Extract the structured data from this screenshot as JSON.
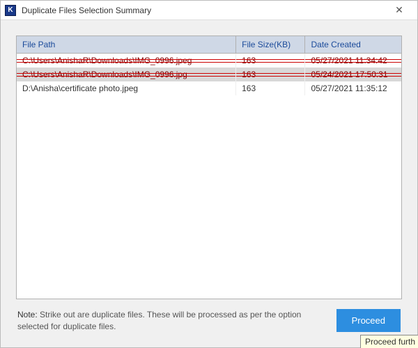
{
  "window": {
    "title": "Duplicate Files Selection Summary",
    "icon_letter": "K"
  },
  "table": {
    "headers": {
      "path": "File Path",
      "size": "File Size(KB)",
      "date": "Date Created"
    },
    "rows": [
      {
        "path": "C:\\Users\\AnishaR\\Downloads\\IMG_0996.jpeg",
        "size": "163",
        "date": "05/27/2021 11:34:42",
        "strike": true
      },
      {
        "path": "C:\\Users\\AnishaR\\Downloads\\IMG_0996.jpg",
        "size": "163",
        "date": "05/24/2021 17:50:31",
        "strike": true
      },
      {
        "path": "D:\\Anisha\\certificate photo.jpeg",
        "size": "163",
        "date": "05/27/2021 11:35:12",
        "strike": false
      }
    ]
  },
  "footer": {
    "note_label": "Note:",
    "note_text": "Strike out are duplicate files. These will be processed as per the option selected for duplicate files.",
    "proceed_label": "Proceed"
  },
  "tooltip_fragment": "Proceed furth"
}
